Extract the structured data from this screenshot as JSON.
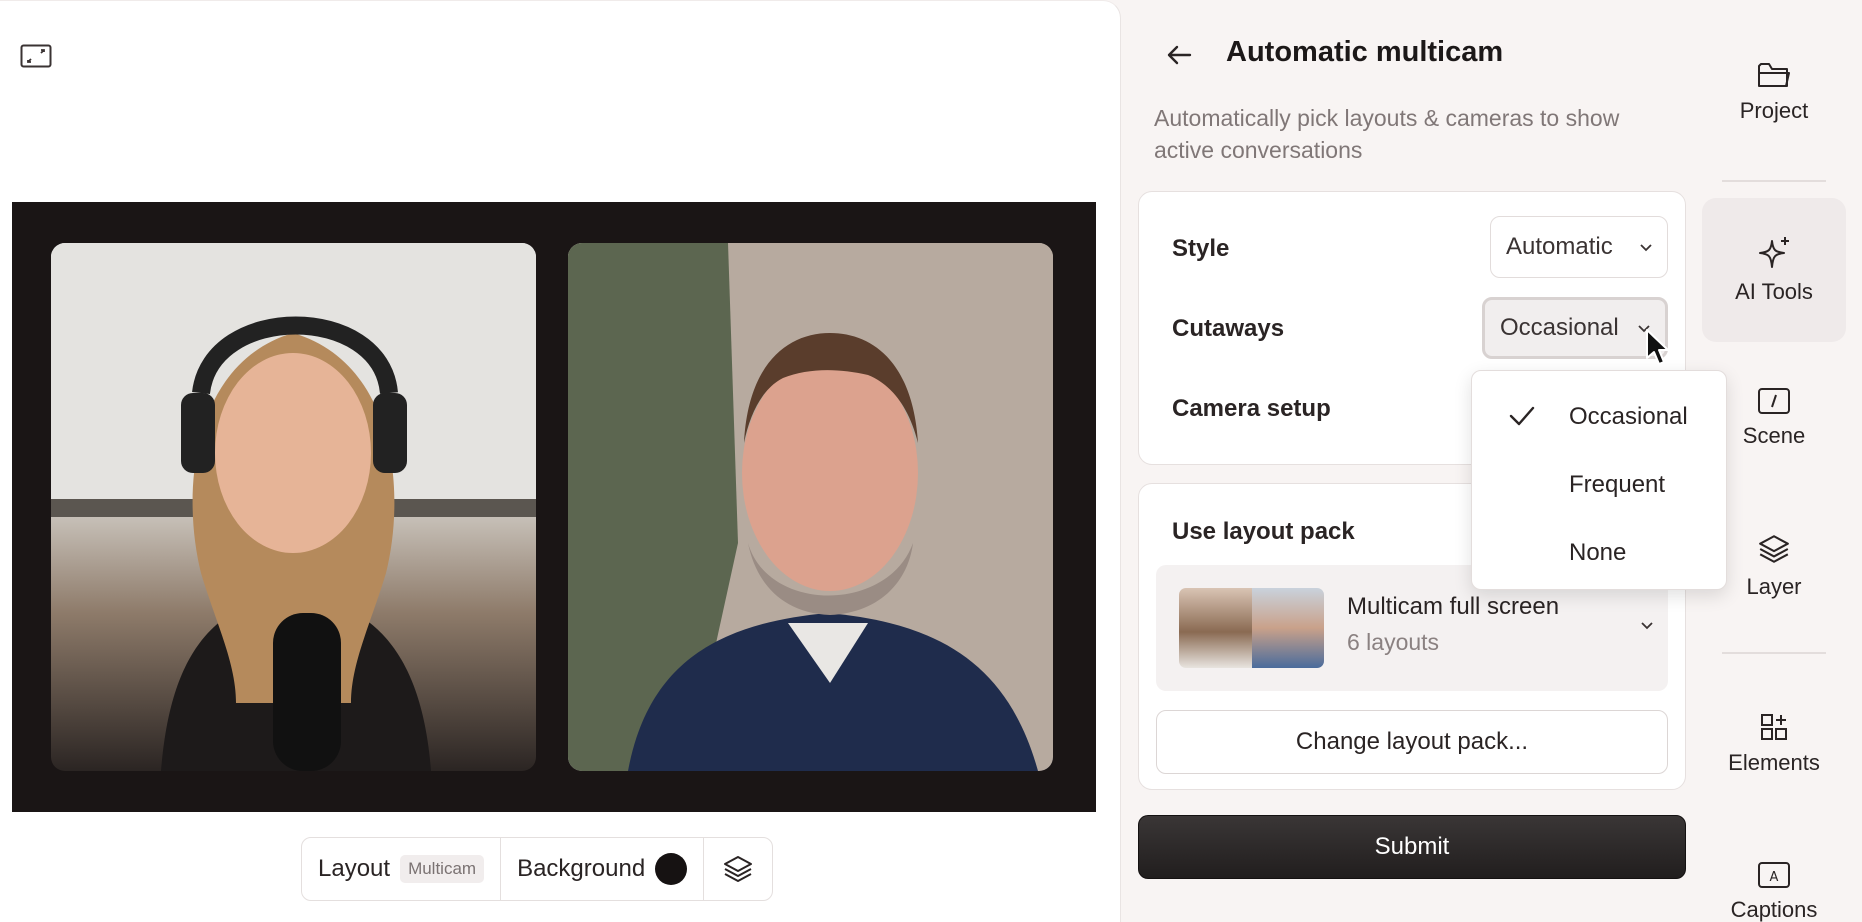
{
  "canvas": {
    "toolbar": {
      "layout_label": "Layout",
      "layout_badge": "Multicam",
      "background_label": "Background",
      "background_color": "#161212"
    }
  },
  "panel": {
    "title": "Automatic multicam",
    "description": "Automatically pick layouts & cameras to show active conversations",
    "style": {
      "label": "Style",
      "value": "Automatic"
    },
    "cutaways": {
      "label": "Cutaways",
      "value": "Occasional"
    },
    "camera_setup": {
      "label": "Camera setup"
    },
    "layout_pack": {
      "label": "Use layout pack",
      "name": "Multicam full screen",
      "count": "6 layouts",
      "change_label": "Change layout pack..."
    },
    "submit_label": "Submit"
  },
  "dropdown": {
    "options": [
      "Occasional",
      "Frequent",
      "None"
    ],
    "selected": "Occasional"
  },
  "rail": {
    "items": [
      {
        "label": "Project",
        "icon": "folder-icon"
      },
      {
        "label": "AI Tools",
        "icon": "sparkle-icon",
        "active": true
      },
      {
        "label": "Scene",
        "icon": "scene-icon"
      },
      {
        "label": "Layer",
        "icon": "layers-icon"
      },
      {
        "label": "Elements",
        "icon": "elements-icon"
      },
      {
        "label": "Captions",
        "icon": "captions-icon"
      }
    ]
  },
  "colors": {
    "accent_dark": "#211e1e",
    "panel_bg": "#f8f4f3",
    "video_bg": "#1a1515"
  }
}
